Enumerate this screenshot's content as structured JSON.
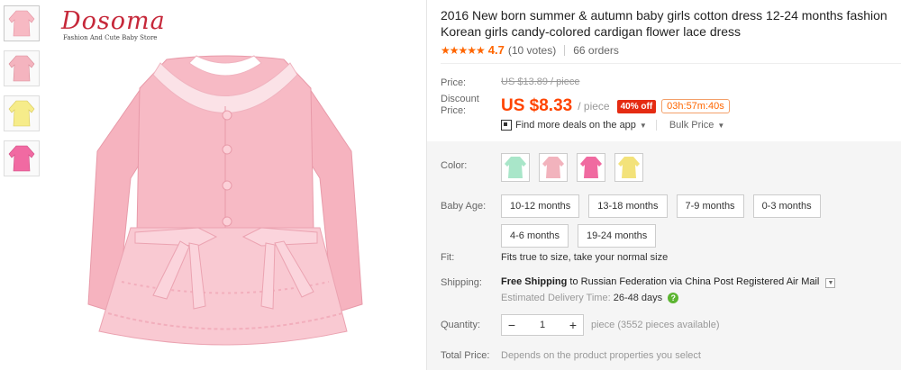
{
  "brand": {
    "name": "Dosoma",
    "tagline": "Fashion And Cute Baby Store"
  },
  "thumbnails": [
    {
      "name": "pink-cardigan",
      "color": "#f7b9c3"
    },
    {
      "name": "pink-cardigan-alt",
      "color": "#f4b4bf"
    },
    {
      "name": "yellow-cardigan",
      "color": "#f6ec8a"
    },
    {
      "name": "rose-cardigan",
      "color": "#f16aa2"
    }
  ],
  "product": {
    "title": "2016 New born summer & autumn baby girls cotton dress 12-24 months fashion Korean girls candy-colored cardigan flower lace dress",
    "stars": "★★★★★",
    "rating": "4.7",
    "votes": "(10 votes)",
    "orders": "66 orders"
  },
  "pricing": {
    "price_label": "Price:",
    "original_price": "US $13.89 / piece",
    "discount_label_line1": "Discount",
    "discount_label_line2": "Price:",
    "discount_price": "US $8.33",
    "per_piece": "/ piece",
    "off_badge": "40% off",
    "countdown": "03h:57m:40s",
    "deals_text": "Find more deals on the app",
    "bulk_text": "Bulk Price"
  },
  "options": {
    "color_label": "Color:",
    "color_swatches": [
      "#a9e6c9",
      "#f2b3bd",
      "#f06aa0",
      "#f3e27a"
    ],
    "size_label": "Baby Age:",
    "sizes": [
      "10-12 months",
      "13-18 months",
      "7-9 months",
      "0-3 months",
      "4-6 months",
      "19-24 months"
    ],
    "fit_label": "Fit:",
    "fit_value": "Fits true to size, take your normal size"
  },
  "shipping": {
    "label": "Shipping:",
    "free": "Free Shipping",
    "destination": " to Russian Federation via China Post Registered Air Mail",
    "delivery_label": "Estimated Delivery Time: ",
    "delivery_days": "26-48 days"
  },
  "quantity": {
    "label": "Quantity:",
    "minus": "−",
    "value": "1",
    "plus": "+",
    "available": "piece (3552 pieces available)"
  },
  "total": {
    "label": "Total Price:",
    "value": "Depends on the product properties you select"
  }
}
